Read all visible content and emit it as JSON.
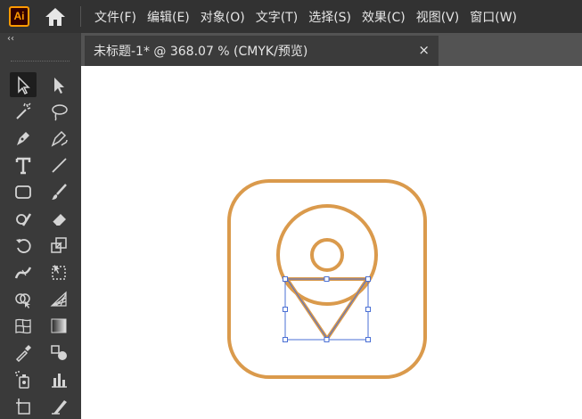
{
  "app": {
    "logo_text": "Ai",
    "accent": "#ff9a00",
    "logo_bg": "#330000"
  },
  "menu": {
    "items": [
      "文件(F)",
      "编辑(E)",
      "对象(O)",
      "文字(T)",
      "选择(S)",
      "效果(C)",
      "视图(V)",
      "窗口(W)"
    ]
  },
  "toolbar": {
    "collapse_glyph": "‹‹",
    "tools": [
      [
        "selection-tool-icon",
        "direct-selection-tool-icon"
      ],
      [
        "magic-wand-tool-icon",
        "lasso-tool-icon"
      ],
      [
        "pen-tool-icon",
        "curvature-tool-icon"
      ],
      [
        "type-tool-icon",
        "line-segment-tool-icon"
      ],
      [
        "rectangle-tool-icon",
        "paintbrush-tool-icon"
      ],
      [
        "shaper-tool-icon",
        "eraser-tool-icon"
      ],
      [
        "rotate-tool-icon",
        "scale-tool-icon"
      ],
      [
        "width-tool-icon",
        "free-transform-tool-icon"
      ],
      [
        "shape-builder-tool-icon",
        "perspective-grid-tool-icon"
      ],
      [
        "mesh-tool-icon",
        "gradient-tool-icon"
      ],
      [
        "eyedropper-tool-icon",
        "blend-tool-icon"
      ],
      [
        "symbol-sprayer-tool-icon",
        "column-graph-tool-icon"
      ],
      [
        "artboard-tool-icon",
        "slice-tool-icon"
      ]
    ],
    "selected_tool": "selection-tool-icon"
  },
  "document": {
    "tab_title": "未标题-1* @ 368.07 % (CMYK/预览)",
    "close_glyph": "×"
  },
  "artwork": {
    "stroke_color": "#da9a4c",
    "selection_color": "#4a6fd4"
  }
}
